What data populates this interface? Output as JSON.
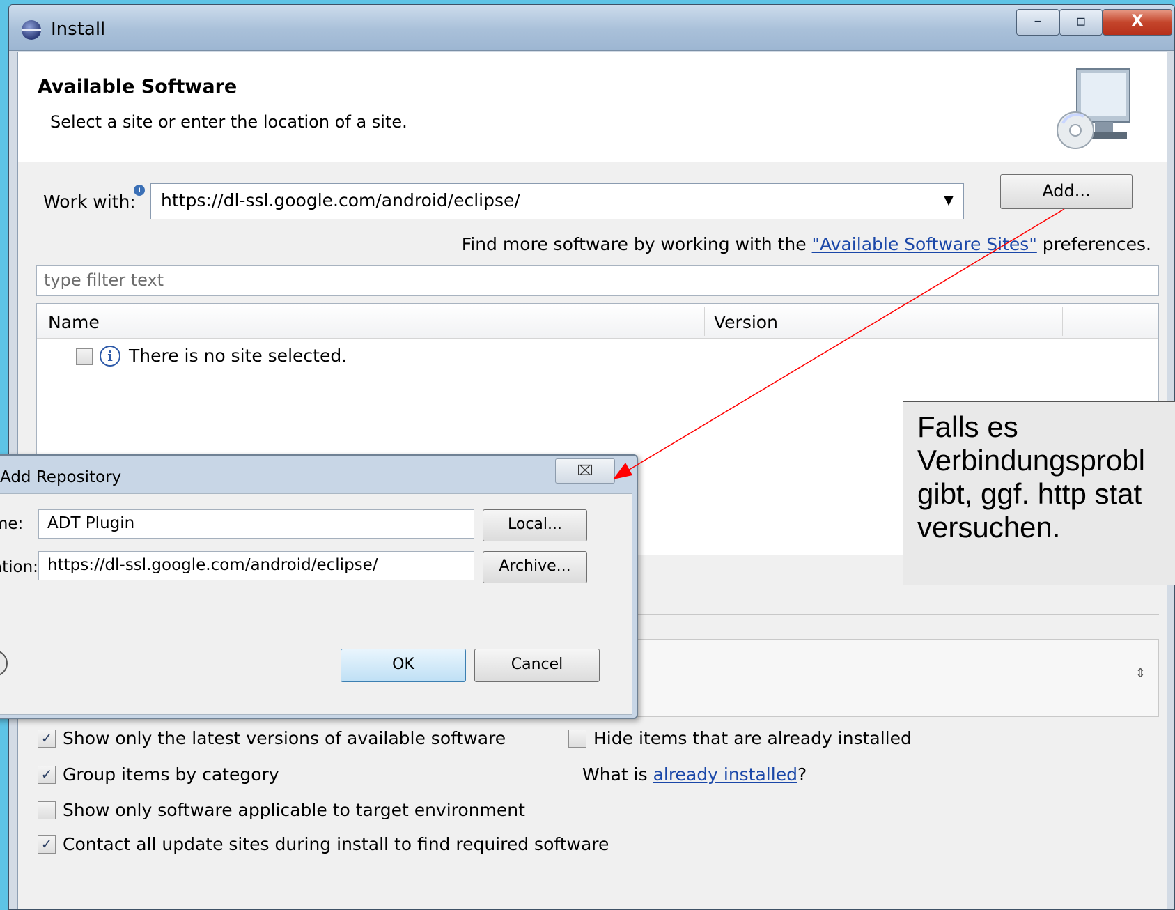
{
  "window": {
    "title": "Install",
    "controls": {
      "minimize": "–",
      "maximize": "▫",
      "close": "X"
    }
  },
  "header": {
    "title": "Available Software",
    "description": "Select a site or enter the location of a site."
  },
  "work_with": {
    "label": "Work with:",
    "value": "https://dl-ssl.google.com/android/eclipse/",
    "add_label": "Add..."
  },
  "find_more": {
    "prefix": "Find more software by working with the ",
    "link": "\"Available Software Sites\"",
    "suffix": " preferences."
  },
  "filter": {
    "placeholder": "type filter text"
  },
  "tree": {
    "columns": [
      "Name",
      "Version"
    ],
    "rows": [
      {
        "checked": false,
        "text": "There is no site selected."
      }
    ]
  },
  "options": {
    "show_latest": {
      "label": "Show only the latest versions of available software",
      "checked": true
    },
    "hide_installed": {
      "label": "Hide items that are already installed",
      "checked": false
    },
    "group_category": {
      "label": "Group items by category",
      "checked": true
    },
    "target_env": {
      "label": "Show only software applicable to target environment",
      "checked": false
    },
    "contact_sites": {
      "label": "Contact all update sites during install to find required software",
      "checked": true
    }
  },
  "what_installed": {
    "prefix": "What is ",
    "link": "already installed",
    "suffix": "?"
  },
  "dialog": {
    "title": "Add Repository",
    "name_label": "me:",
    "name_value": "ADT Plugin",
    "location_label": "ation:",
    "location_value": "https://dl-ssl.google.com/android/eclipse/",
    "local_label": "Local...",
    "archive_label": "Archive...",
    "ok_label": "OK",
    "cancel_label": "Cancel",
    "help_glyph": "?",
    "close_glyph": "⌧"
  },
  "callout": {
    "lines": [
      "Falls es",
      "Verbindungsprobl",
      "gibt, ggf. http stat",
      "versuchen."
    ]
  },
  "colors": {
    "arrow": "#ff0000",
    "link": "#1a47a8",
    "ok_border": "#3c7fb1"
  }
}
